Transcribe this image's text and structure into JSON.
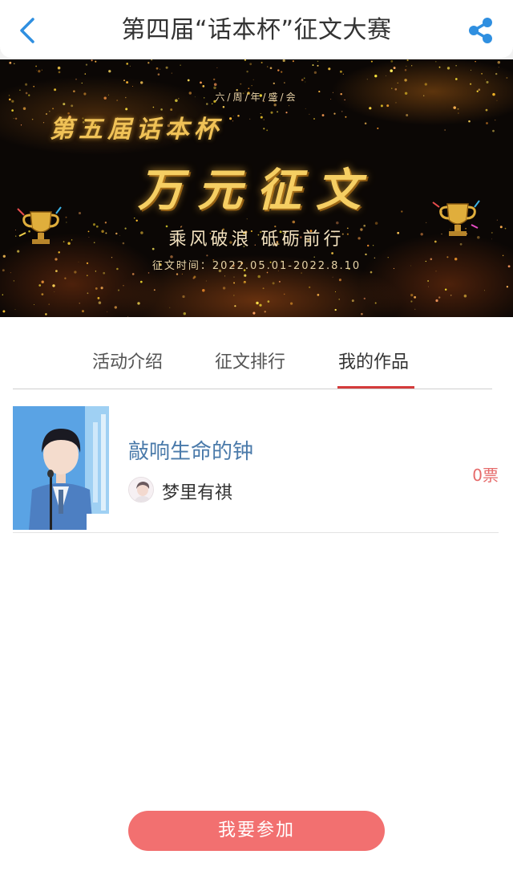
{
  "header": {
    "title": "第四届“话本杯”征文大赛",
    "back_icon": "chevron-left-icon",
    "share_icon": "share-icon",
    "icon_color": "#2f8fe0"
  },
  "banner": {
    "anniversary": "六/周/年/盛/会",
    "edition": "第五届话本杯",
    "main": "万元征文",
    "slogan": "乘风破浪 砥砺前行",
    "dates": "征文时间：2022.05.01-2022.8.10",
    "trophy_icon": "trophy-icon"
  },
  "tabs": [
    {
      "label": "活动介绍"
    },
    {
      "label": "征文排行"
    },
    {
      "label": "我的作品"
    }
  ],
  "active_tab": "我的作品",
  "works": [
    {
      "title": "敲响生命的钟",
      "author": "梦里有祺",
      "votes": "0票"
    }
  ],
  "join_button": {
    "label": "我要参加"
  },
  "colors": {
    "accent_red": "#d43b3b",
    "button_bg": "#f27070",
    "vote_color": "#e66b6b",
    "work_title_color": "#4a7aaa"
  }
}
